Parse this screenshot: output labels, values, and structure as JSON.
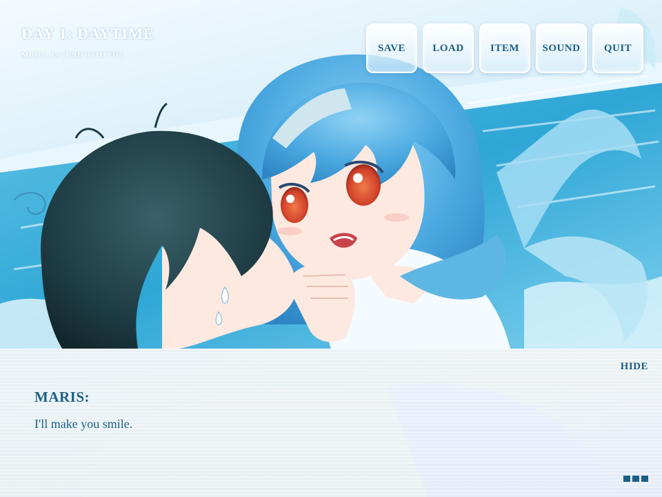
{
  "header": {
    "day_title": "DAY 1: DAYTIME",
    "music": "MUSIC: IN TUNE WITH YOU"
  },
  "menu": {
    "save": "SAVE",
    "load": "LOAD",
    "item": "ITEM",
    "sound": "SOUND",
    "quit": "QUIT"
  },
  "dialogue": {
    "hide_label": "HIDE",
    "speaker": "MARIS:",
    "text": "I'll make you smile."
  },
  "icons": {
    "advance": "advance-dots-icon"
  },
  "colors": {
    "ui_text": "#1c5f86",
    "sea": "#3fb0d9",
    "sky": "#dff1fa",
    "girl_hair": "#4aa8e0",
    "boy_hair": "#1d3a42",
    "skin": "#fde9e0",
    "eyes": "#d2432a"
  }
}
